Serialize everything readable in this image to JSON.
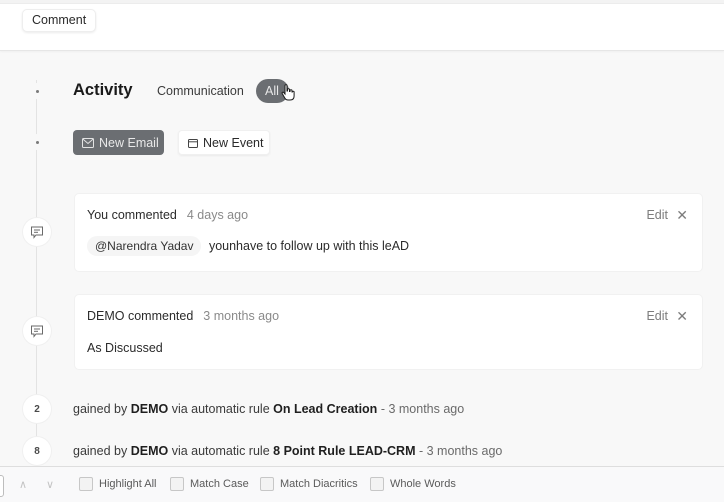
{
  "top_panel": {
    "comment_tab_label": "Comment"
  },
  "activity": {
    "title": "Activity",
    "tabs": [
      {
        "label": "Communication",
        "active": false
      },
      {
        "label": "All",
        "active": true
      }
    ],
    "actions": {
      "new_email_label": "New Email",
      "new_event_label": "New Event"
    }
  },
  "timeline": [
    {
      "type": "comment",
      "author_text": "You commented",
      "time": "4 days ago",
      "mention": "@Narendra Yadav",
      "body": "younhave to follow up with this leAD",
      "edit_label": "Edit",
      "close_icon": "close-icon"
    },
    {
      "type": "comment",
      "author_text": "DEMO commented",
      "time": "3 months ago",
      "body": "As Discussed",
      "edit_label": "Edit",
      "close_icon": "close-icon"
    },
    {
      "type": "points",
      "points": "2",
      "prefix": "gained by",
      "user": "DEMO",
      "middle": "via automatic rule",
      "rule": "On Lead Creation",
      "time": "- 3 months ago"
    },
    {
      "type": "points",
      "points": "8",
      "prefix": "gained by",
      "user": "DEMO",
      "middle": "via automatic rule",
      "rule": "8 Point Rule LEAD-CRM",
      "time": "- 3 months ago"
    }
  ],
  "find_bar": {
    "options": [
      {
        "label": "Highlight All",
        "checked": false
      },
      {
        "label": "Match Case",
        "checked": false
      },
      {
        "label": "Match Diacritics",
        "checked": false
      },
      {
        "label": "Whole Words",
        "checked": false
      }
    ]
  },
  "colors": {
    "accent_dark": "#6b6e72",
    "page_bg": "#f8f8f8",
    "card_bg": "#ffffff"
  }
}
